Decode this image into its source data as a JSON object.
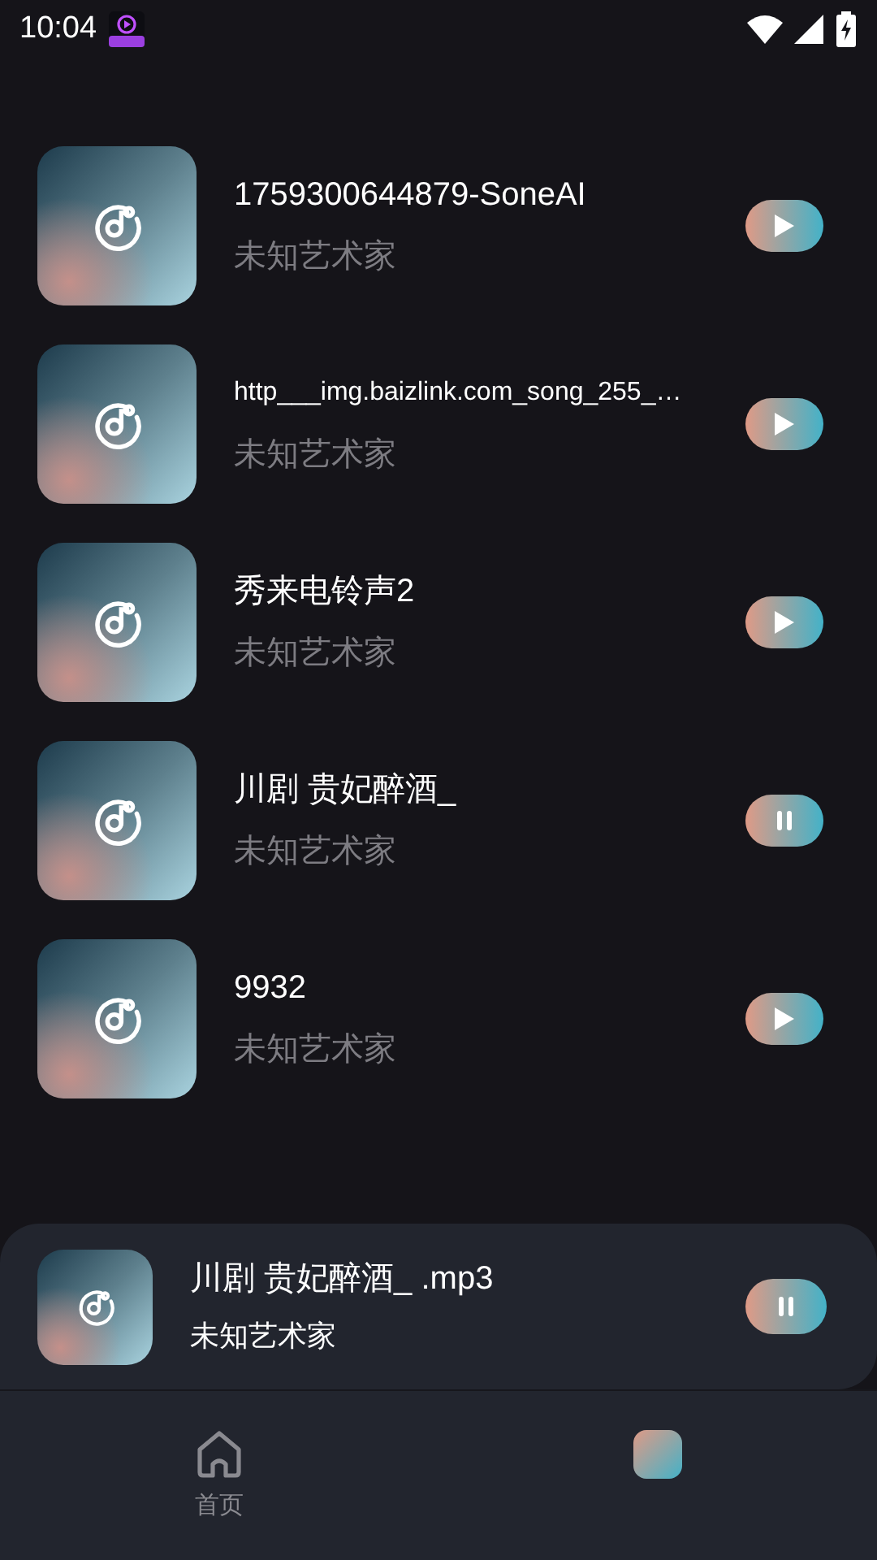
{
  "status_bar": {
    "time": "10:04"
  },
  "songs": [
    {
      "title": "1759300644879-SoneAI",
      "artist": "未知艺术家",
      "playing": false
    },
    {
      "title": "http___img.baizlink.com_song_255_…",
      "artist": "未知艺术家",
      "playing": false
    },
    {
      "title": "秀来电铃声2",
      "artist": "未知艺术家",
      "playing": false
    },
    {
      "title": "川剧 贵妃醉酒_",
      "artist": "未知艺术家",
      "playing": true
    },
    {
      "title": "9932",
      "artist": "未知艺术家",
      "playing": false
    }
  ],
  "now_playing": {
    "title": "川剧 贵妃醉酒_ .mp3",
    "artist": "未知艺术家",
    "playing": true
  },
  "nav_tabs": [
    {
      "kind": "home",
      "label": "首页",
      "selected": false
    },
    {
      "kind": "music",
      "selected": true
    }
  ]
}
